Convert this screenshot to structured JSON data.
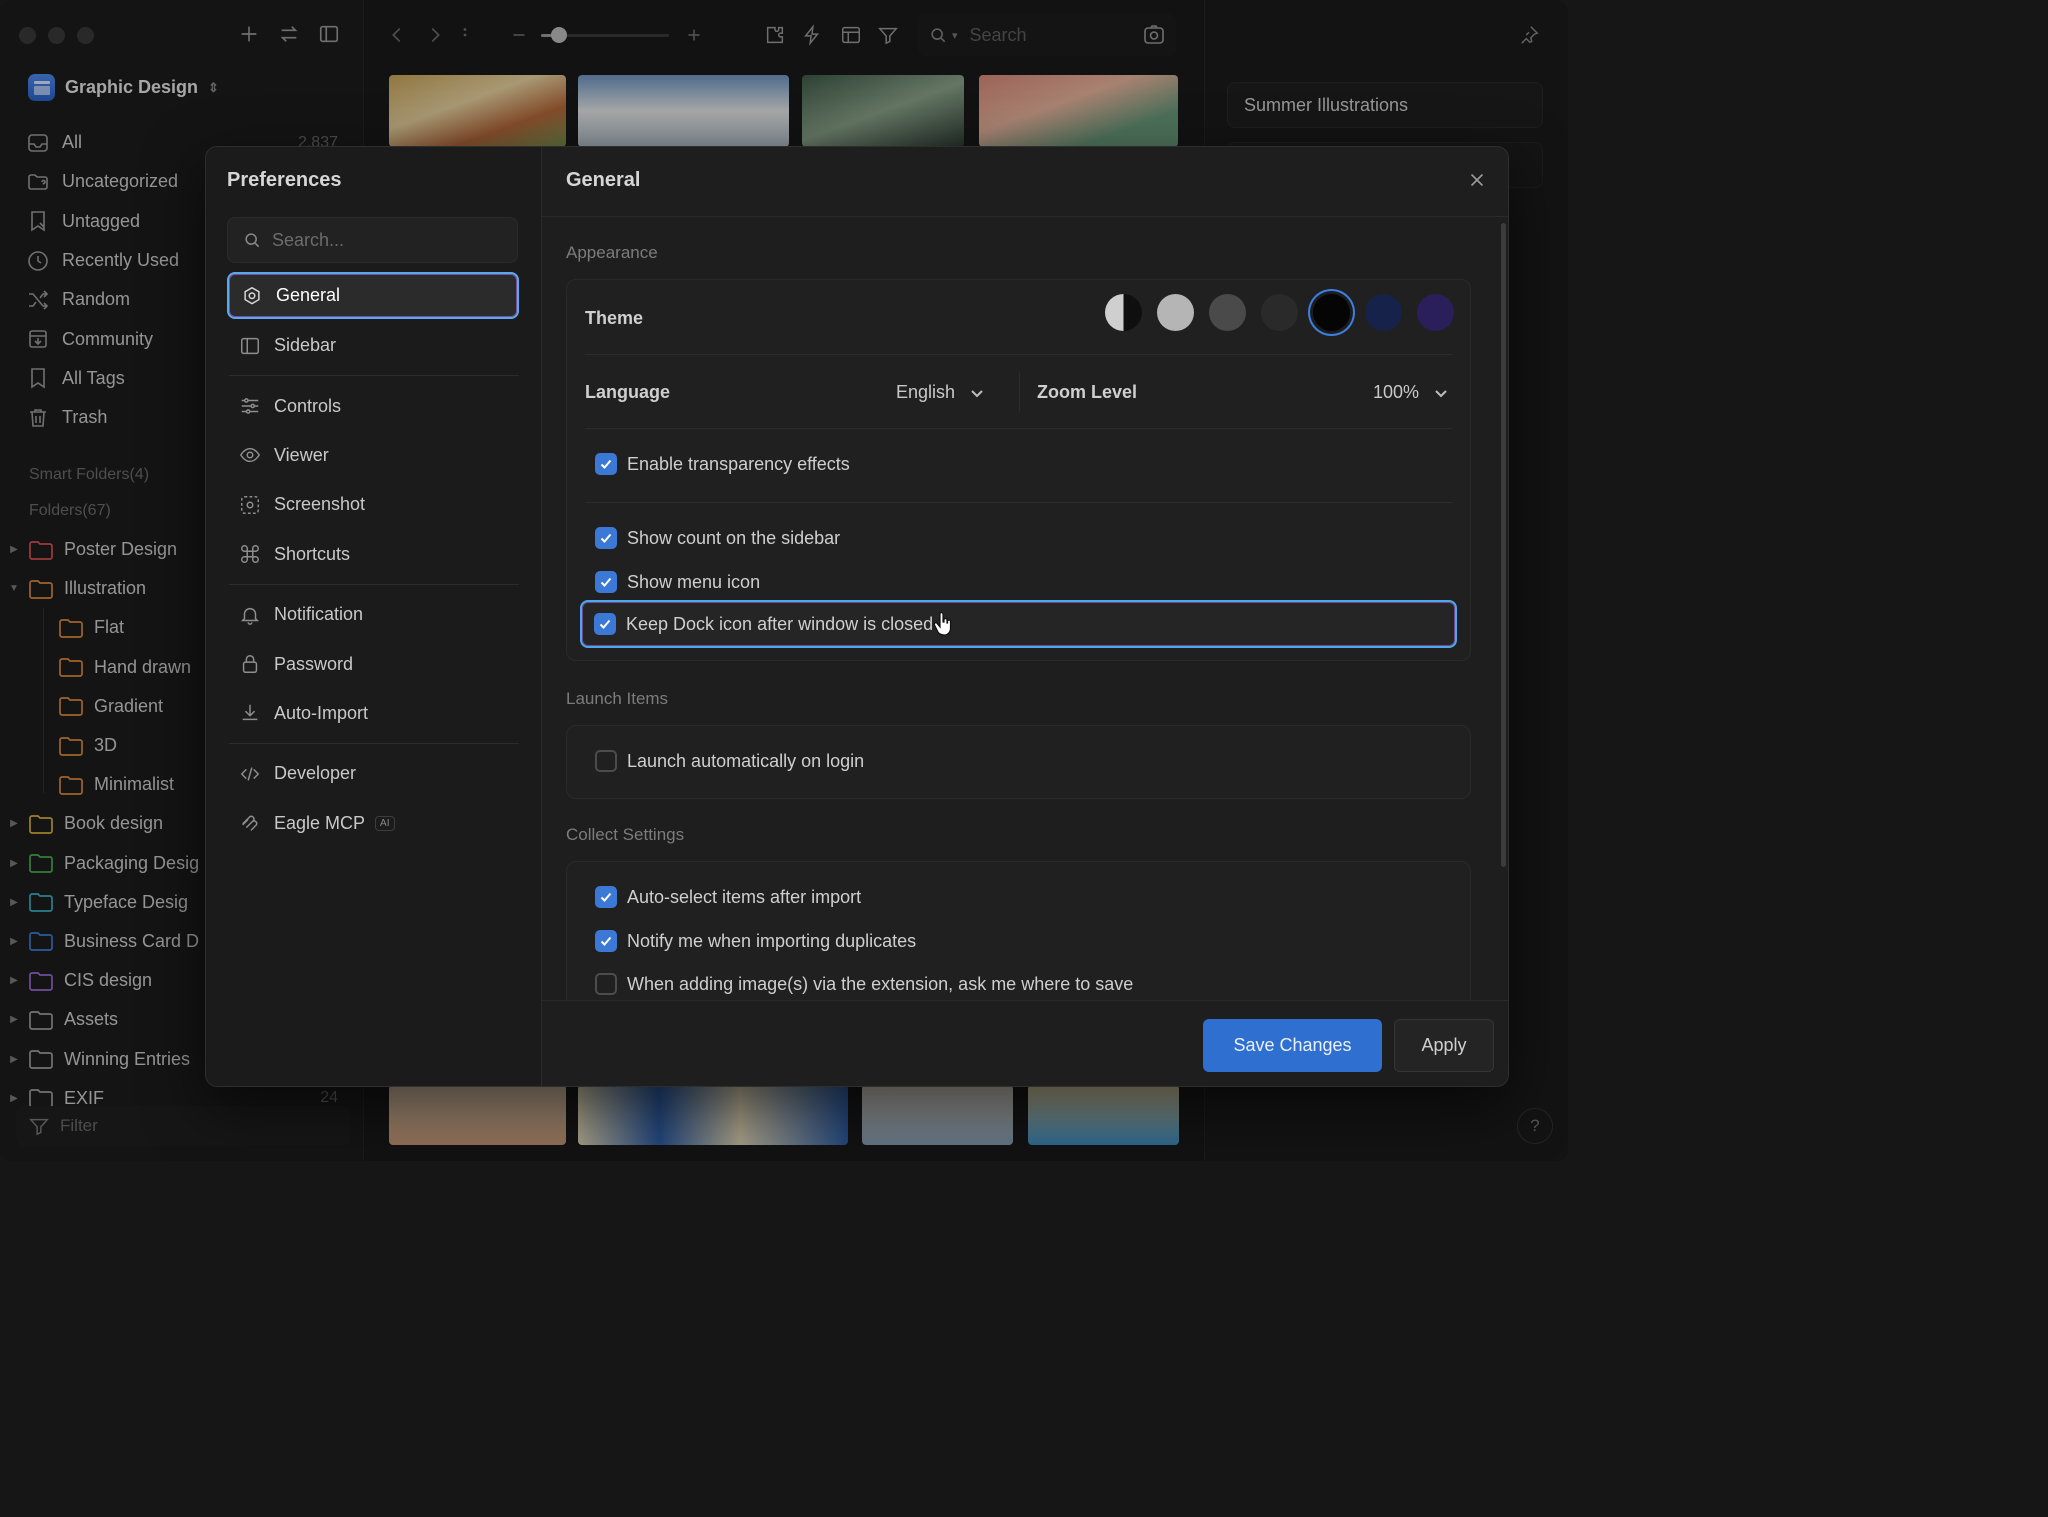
{
  "sidebar": {
    "library_name": "Graphic Design",
    "nav": [
      {
        "label": "All",
        "count": "2,837",
        "icon": "all-items-icon"
      },
      {
        "label": "Uncategorized",
        "icon": "folder-question-icon"
      },
      {
        "label": "Untagged",
        "icon": "tag-off-icon"
      },
      {
        "label": "Recently Used",
        "icon": "clock-icon"
      },
      {
        "label": "Random",
        "icon": "shuffle-icon"
      },
      {
        "label": "Community",
        "icon": "community-icon"
      },
      {
        "label": "All Tags",
        "icon": "bookmark-icon"
      },
      {
        "label": "Trash",
        "icon": "trash-icon"
      }
    ],
    "smart_folders_label": "Smart Folders(4)",
    "folders_label": "Folders(67)",
    "folders": [
      {
        "label": "Poster Design",
        "color": "#d9534f"
      },
      {
        "label": "Illustration",
        "color": "#e08a3c"
      },
      {
        "label": "Flat",
        "color": "#e08a3c"
      },
      {
        "label": "Hand drawn",
        "color": "#e08a3c"
      },
      {
        "label": "Gradient",
        "color": "#e08a3c"
      },
      {
        "label": "3D",
        "color": "#e08a3c"
      },
      {
        "label": "Minimalist",
        "color": "#e08a3c"
      },
      {
        "label": "Book design",
        "color": "#d9b23c"
      },
      {
        "label": "Packaging Desig",
        "color": "#4caf50"
      },
      {
        "label": "Typeface Desig",
        "color": "#3ab0c4"
      },
      {
        "label": "Business Card D",
        "color": "#3c7fd8"
      },
      {
        "label": "CIS design",
        "color": "#9b6bd6"
      },
      {
        "label": "Assets",
        "color": "#a0a0a0"
      },
      {
        "label": "Winning Entries",
        "color": "#a0a0a0"
      },
      {
        "label": "EXIF",
        "count": "24",
        "color": "#a0a0a0"
      }
    ],
    "filter_placeholder": "Filter"
  },
  "toolbar": {
    "search_placeholder": "Search",
    "zoom_slider_fraction": 0.14
  },
  "inspector": {
    "title_value": "Summer Illustrations",
    "help_label": "?"
  },
  "preferences": {
    "title": "Preferences",
    "search_placeholder": "Search...",
    "nav": [
      {
        "label": "General",
        "icon": "gear-icon",
        "active": true
      },
      {
        "label": "Sidebar",
        "icon": "sidebar-icon"
      },
      {
        "label": "Controls",
        "icon": "sliders-icon"
      },
      {
        "label": "Viewer",
        "icon": "eye-icon"
      },
      {
        "label": "Screenshot",
        "icon": "screenshot-icon"
      },
      {
        "label": "Shortcuts",
        "icon": "command-icon"
      },
      {
        "label": "Notification",
        "icon": "bell-icon"
      },
      {
        "label": "Password",
        "icon": "lock-icon"
      },
      {
        "label": "Auto-Import",
        "icon": "download-icon"
      },
      {
        "label": "Developer",
        "icon": "code-icon"
      },
      {
        "label": "Eagle MCP",
        "icon": "mcp-icon",
        "badge": "AI"
      }
    ]
  },
  "general": {
    "title": "General",
    "appearance_label": "Appearance",
    "theme_label": "Theme",
    "theme_swatches": [
      "#auto",
      "#b5b5b5",
      "#4a4a4a",
      "#2a2a2a",
      "#050505",
      "#17224a",
      "#2a1f5a"
    ],
    "language_label": "Language",
    "language_value": "English",
    "zoom_label": "Zoom Level",
    "zoom_value": "100%",
    "appearance_options": [
      {
        "label": "Enable transparency effects",
        "checked": true
      },
      {
        "label": "Show count on the sidebar",
        "checked": true
      },
      {
        "label": "Show menu icon",
        "checked": true
      },
      {
        "label": "Keep Dock icon after window is closed",
        "checked": true
      }
    ],
    "launch_label": "Launch Items",
    "launch_options": [
      {
        "label": "Launch automatically on login",
        "checked": false
      }
    ],
    "collect_label": "Collect Settings",
    "collect_options": [
      {
        "label": "Auto-select items after import",
        "checked": true
      },
      {
        "label": "Notify me when importing duplicates",
        "checked": true
      },
      {
        "label": "When adding image(s) via the extension, ask me where to save",
        "checked": false
      }
    ],
    "save_label": "Save Changes",
    "apply_label": "Apply"
  },
  "colors": {
    "accent": "#2f6fd0",
    "focus_ring": "#4fa6f0"
  }
}
